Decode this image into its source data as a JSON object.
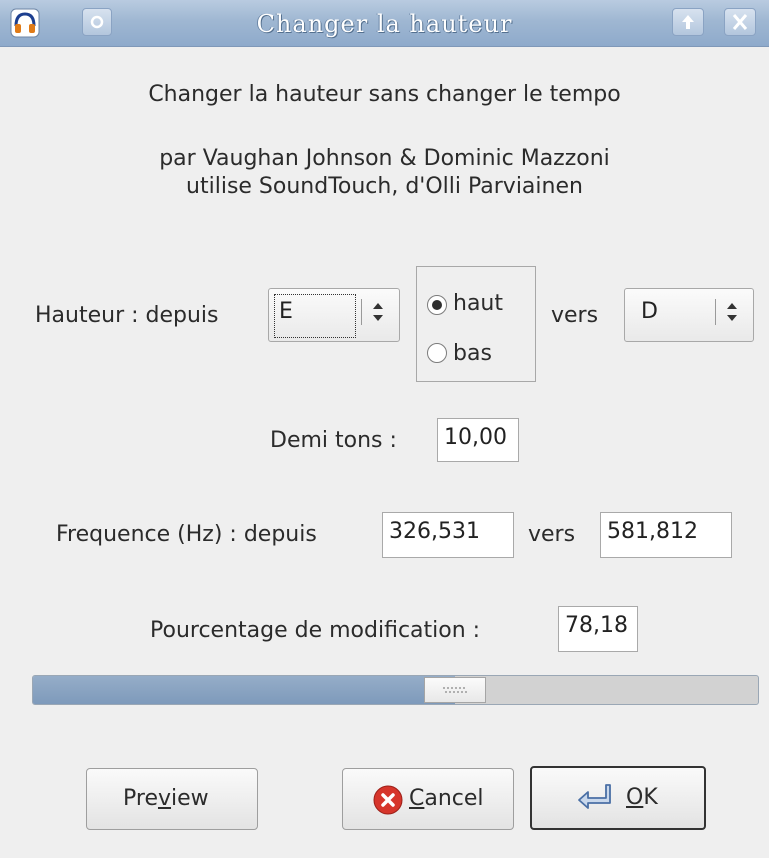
{
  "window": {
    "title": "Changer la hauteur",
    "app_icon": "audacity-headphones-icon",
    "menu_icon": "window-menu-icon",
    "maximize_icon": "up-arrow-icon",
    "close_icon": "close-x-icon"
  },
  "header": {
    "description": "Changer la hauteur sans changer le tempo",
    "credits_line1": "par Vaughan Johnson & Dominic Mazzoni",
    "credits_line2": "utilise SoundTouch, d'Olli Parviainen"
  },
  "pitch": {
    "label": "Hauteur : depuis",
    "from_value": "E",
    "direction_options": [
      "haut",
      "bas"
    ],
    "direction_selected": "haut",
    "to_label": "vers",
    "to_value": "D"
  },
  "semitones": {
    "label": "Demi tons :",
    "value": "10,00"
  },
  "frequency": {
    "label": "Frequence (Hz) : depuis",
    "from_value": "326,531",
    "to_label": "vers",
    "to_value": "581,812"
  },
  "percent": {
    "label": "Pourcentage de modification :",
    "value": "78,18"
  },
  "slider": {
    "level_fraction": 0.59
  },
  "buttons": {
    "preview_pre": "Pre",
    "preview_accel": "v",
    "preview_post": "iew",
    "cancel_accel": "C",
    "cancel_rest": "ancel",
    "ok_accel": "O",
    "ok_rest": "K"
  },
  "colors": {
    "titlebar": "#9fb7d2",
    "slider_fill": "#8aa4c3",
    "cancel_icon": "#d6352b"
  }
}
